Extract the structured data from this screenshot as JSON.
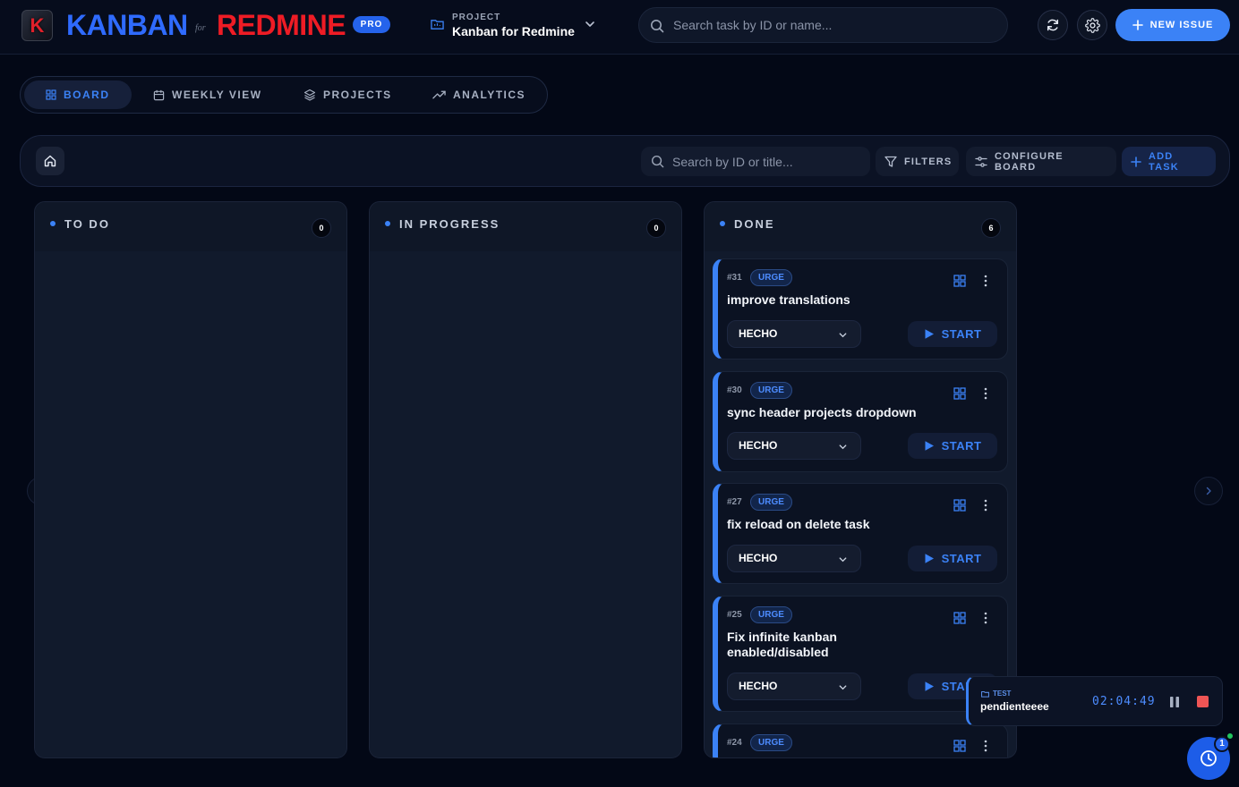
{
  "brand": {
    "logo_letter": "K",
    "name_part1": "KANBAN",
    "connector": "for",
    "name_part2": "REDMINE",
    "badge": "PRO"
  },
  "project_selector": {
    "label": "PROJECT",
    "value": "Kanban for Redmine"
  },
  "top_search": {
    "placeholder": "Search task by ID or name..."
  },
  "header_actions": {
    "new_issue_label": "NEW ISSUE"
  },
  "tabs": [
    {
      "label": "BOARD",
      "icon": "grid-icon",
      "active": true
    },
    {
      "label": "WEEKLY VIEW",
      "icon": "calendar-icon",
      "active": false
    },
    {
      "label": "PROJECTS",
      "icon": "layers-icon",
      "active": false
    },
    {
      "label": "ANALYTICS",
      "icon": "trending-icon",
      "active": false
    }
  ],
  "toolbar": {
    "search_placeholder": "Search by ID or title...",
    "filters_label": "FILTERS",
    "configure_label": "CONFIGURE BOARD",
    "add_task_label": "ADD TASK"
  },
  "columns": [
    {
      "title": "TO DO",
      "count": "0"
    },
    {
      "title": "IN PROGRESS",
      "count": "0"
    },
    {
      "title": "DONE",
      "count": "6"
    }
  ],
  "done_cards": [
    {
      "id": "#31",
      "priority": "URGE",
      "title": "improve translations",
      "status": "HECHO",
      "action": "START"
    },
    {
      "id": "#30",
      "priority": "URGE",
      "title": "sync header projects dropdown",
      "status": "HECHO",
      "action": "START"
    },
    {
      "id": "#27",
      "priority": "URGE",
      "title": "fix reload on delete task",
      "status": "HECHO",
      "action": "START"
    },
    {
      "id": "#25",
      "priority": "URGE",
      "title": "Fix infinite kanban enabled/disabled",
      "status": "HECHO",
      "action": "START"
    },
    {
      "id": "#24",
      "priority": "URGE"
    }
  ],
  "timer": {
    "project": "TEST",
    "task": "pendienteeee",
    "elapsed": "02:04:49"
  },
  "fab": {
    "badge": "1"
  },
  "colors": {
    "accent": "#3b82f6",
    "brand_blue": "#2f6bff",
    "brand_red": "#ee1c25",
    "background": "#030816",
    "stop": "#ef5555",
    "online": "#22c55e"
  }
}
